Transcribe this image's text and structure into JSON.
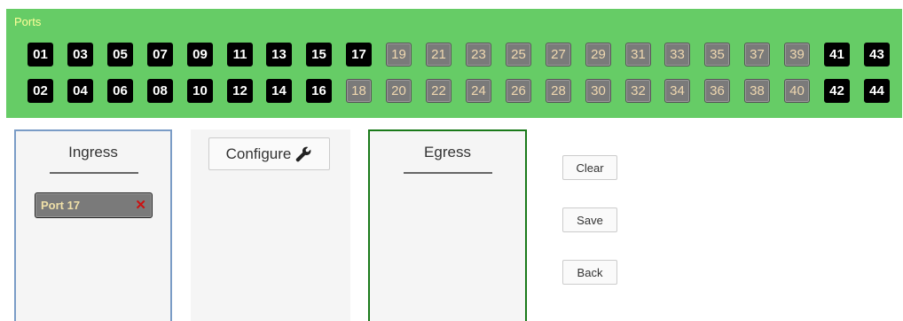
{
  "ports": {
    "title": "Ports",
    "top_row": [
      {
        "label": "01",
        "state": "active"
      },
      {
        "label": "03",
        "state": "active"
      },
      {
        "label": "05",
        "state": "active"
      },
      {
        "label": "07",
        "state": "active"
      },
      {
        "label": "09",
        "state": "active"
      },
      {
        "label": "11",
        "state": "active"
      },
      {
        "label": "13",
        "state": "active"
      },
      {
        "label": "15",
        "state": "active"
      },
      {
        "label": "17",
        "state": "active"
      },
      {
        "label": "19",
        "state": "inactive"
      },
      {
        "label": "21",
        "state": "inactive"
      },
      {
        "label": "23",
        "state": "inactive"
      },
      {
        "label": "25",
        "state": "inactive"
      },
      {
        "label": "27",
        "state": "inactive"
      },
      {
        "label": "29",
        "state": "inactive"
      },
      {
        "label": "31",
        "state": "inactive"
      },
      {
        "label": "33",
        "state": "inactive"
      },
      {
        "label": "35",
        "state": "inactive"
      },
      {
        "label": "37",
        "state": "inactive"
      },
      {
        "label": "39",
        "state": "inactive"
      },
      {
        "label": "41",
        "state": "active"
      },
      {
        "label": "43",
        "state": "active"
      }
    ],
    "bottom_row": [
      {
        "label": "02",
        "state": "active"
      },
      {
        "label": "04",
        "state": "active"
      },
      {
        "label": "06",
        "state": "active"
      },
      {
        "label": "08",
        "state": "active"
      },
      {
        "label": "10",
        "state": "active"
      },
      {
        "label": "12",
        "state": "active"
      },
      {
        "label": "14",
        "state": "active"
      },
      {
        "label": "16",
        "state": "active"
      },
      {
        "label": "18",
        "state": "inactive"
      },
      {
        "label": "20",
        "state": "inactive"
      },
      {
        "label": "22",
        "state": "inactive"
      },
      {
        "label": "24",
        "state": "inactive"
      },
      {
        "label": "26",
        "state": "inactive"
      },
      {
        "label": "28",
        "state": "inactive"
      },
      {
        "label": "30",
        "state": "inactive"
      },
      {
        "label": "32",
        "state": "inactive"
      },
      {
        "label": "34",
        "state": "inactive"
      },
      {
        "label": "36",
        "state": "inactive"
      },
      {
        "label": "38",
        "state": "inactive"
      },
      {
        "label": "40",
        "state": "inactive"
      },
      {
        "label": "42",
        "state": "active"
      },
      {
        "label": "44",
        "state": "active"
      }
    ]
  },
  "ingress": {
    "title": "Ingress",
    "items": [
      {
        "label": "Port 17",
        "remove_glyph": "✕"
      }
    ]
  },
  "configure": {
    "label": "Configure",
    "icon": "wrench-icon"
  },
  "egress": {
    "title": "Egress"
  },
  "actions": {
    "clear_label": "Clear",
    "save_label": "Save",
    "back_label": "Back"
  },
  "colors": {
    "panel_bg": "#66cc66",
    "active_port": "#000000",
    "inactive_port": "#7a7a7a",
    "ingress_border": "#7a9cc6",
    "egress_border": "#1a7a1a",
    "remove_x": "#cc1111"
  }
}
